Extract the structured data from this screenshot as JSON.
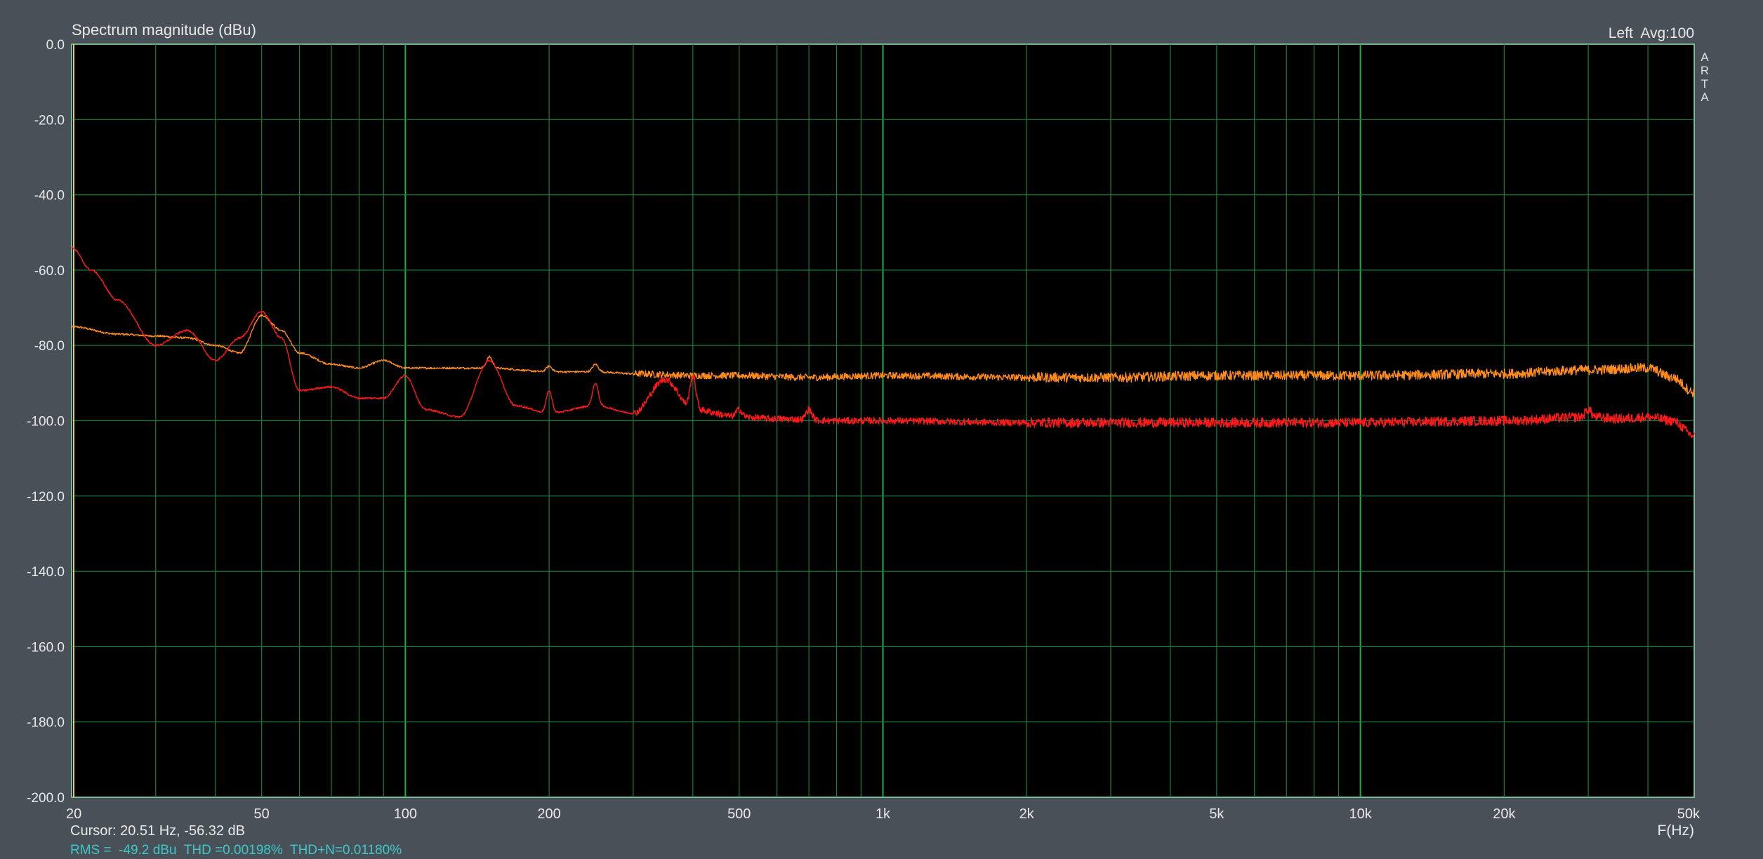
{
  "chart_data": {
    "type": "line",
    "title": "Spectrum magnitude (dBu)",
    "top_right_label": "Left  Avg:100",
    "side_label": "ARTA",
    "xlabel": "F(Hz)",
    "ylabel": "",
    "xscale": "log",
    "xlim": [
      20,
      50000
    ],
    "ylim": [
      -200,
      0
    ],
    "grid": true,
    "x_ticks": [
      {
        "v": 20,
        "label": "20"
      },
      {
        "v": 50,
        "label": "50"
      },
      {
        "v": 100,
        "label": "100"
      },
      {
        "v": 200,
        "label": "200"
      },
      {
        "v": 500,
        "label": "500"
      },
      {
        "v": 1000,
        "label": "1k"
      },
      {
        "v": 2000,
        "label": "2k"
      },
      {
        "v": 5000,
        "label": "5k"
      },
      {
        "v": 10000,
        "label": "10k"
      },
      {
        "v": 20000,
        "label": "20k"
      },
      {
        "v": 50000,
        "label": "50k"
      }
    ],
    "y_ticks": [
      {
        "v": 0,
        "label": "0.0"
      },
      {
        "v": -20,
        "label": "-20.0"
      },
      {
        "v": -40,
        "label": "-40.0"
      },
      {
        "v": -60,
        "label": "-60.0"
      },
      {
        "v": -80,
        "label": "-80.0"
      },
      {
        "v": -100,
        "label": "-100.0"
      },
      {
        "v": -120,
        "label": "-120.0"
      },
      {
        "v": -140,
        "label": "-140.0"
      },
      {
        "v": -160,
        "label": "-160.0"
      },
      {
        "v": -180,
        "label": "-180.0"
      },
      {
        "v": -200,
        "label": "-200.0"
      }
    ],
    "series": [
      {
        "color": "#ff8c1a",
        "x": [
          20,
          25,
          30,
          35,
          40,
          45,
          50,
          55,
          60,
          70,
          80,
          90,
          100,
          120,
          150,
          200,
          250,
          300,
          400,
          500,
          700,
          1000,
          2000,
          3000,
          5000,
          10000,
          20000,
          30000,
          40000,
          45000,
          50000
        ],
        "y": [
          -75,
          -77,
          -77.5,
          -78,
          -80,
          -82,
          -72,
          -76,
          -82,
          -85,
          -86,
          -84,
          -86,
          -86,
          -86,
          -87,
          -87,
          -87.5,
          -88,
          -88,
          -88.5,
          -88,
          -88.5,
          -88.5,
          -88,
          -88,
          -87.5,
          -86.5,
          -86,
          -88.5,
          -92.5
        ]
      },
      {
        "color": "#ff1a1a",
        "x": [
          20,
          22,
          25,
          30,
          35,
          40,
          45,
          50,
          55,
          60,
          70,
          80,
          90,
          100,
          110,
          130,
          150,
          170,
          200,
          250,
          300,
          350,
          400,
          500,
          600,
          800,
          1000,
          2000,
          5000,
          10000,
          20000,
          30000,
          35000,
          40000,
          45000,
          50000
        ],
        "y": [
          -54,
          -60,
          -68,
          -80,
          -76,
          -84,
          -78,
          -71,
          -78,
          -92,
          -91,
          -94,
          -94,
          -88,
          -97,
          -99,
          -84,
          -96,
          -98,
          -96,
          -98,
          -89,
          -97,
          -99,
          -99.5,
          -100,
          -100,
          -100.5,
          -100.5,
          -100.5,
          -100,
          -99,
          -99.5,
          -99,
          -100,
          -104
        ]
      }
    ],
    "peaks": [
      {
        "series": 0,
        "x": 150,
        "y": -83
      },
      {
        "series": 0,
        "x": 200,
        "y": -85.5
      },
      {
        "series": 0,
        "x": 250,
        "y": -85
      },
      {
        "series": 1,
        "x": 200,
        "y": -92
      },
      {
        "series": 1,
        "x": 250,
        "y": -90
      },
      {
        "series": 1,
        "x": 350,
        "y": -89
      },
      {
        "series": 1,
        "x": 400,
        "y": -88
      },
      {
        "series": 1,
        "x": 500,
        "y": -97
      },
      {
        "series": 1,
        "x": 700,
        "y": -97
      },
      {
        "series": 1,
        "x": 30000,
        "y": -97
      }
    ],
    "cursor_readout": "Cursor: 20.51 Hz, -56.32 dB",
    "stats_readout": "RMS =  -49.2 dBu  THD =0.00198%  THD+N=0.01180%"
  }
}
